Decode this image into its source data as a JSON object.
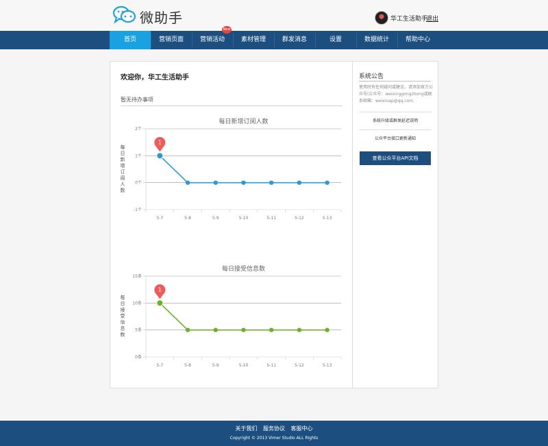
{
  "header": {
    "logo_text": "微助手",
    "username": "华工生活助手",
    "logout": "退出"
  },
  "nav": {
    "items": [
      "首页",
      "营销页面",
      "营销活动",
      "素材管理",
      "群发消息",
      "设置",
      "数据统计",
      "帮助中心"
    ],
    "active_index": 0,
    "badge": "New"
  },
  "main": {
    "welcome": "欢迎你，华工生活助手",
    "todo": "暂无待办事项"
  },
  "chart_data": [
    {
      "type": "line",
      "title": "每日新增订阅人数",
      "ylabel": "每日新增订阅人数",
      "x": [
        "5-7",
        "5-8",
        "5-9",
        "5-10",
        "5-11",
        "5-12",
        "5-13"
      ],
      "y_ticks": [
        "2个",
        "1个",
        "0个",
        "-1个"
      ],
      "ylim": [
        -1,
        2
      ],
      "values": [
        1,
        0,
        0,
        0,
        0,
        0,
        0
      ],
      "color": "#2b9ad6",
      "marker_label": "1",
      "grid": true
    },
    {
      "type": "line",
      "title": "每日接受信息数",
      "ylabel": "每日接受信息数",
      "x": [
        "5-7",
        "5-8",
        "5-9",
        "5-10",
        "5-11",
        "5-12",
        "5-13"
      ],
      "y_ticks": [
        "15条",
        "10条",
        "5条",
        "0条"
      ],
      "ylim": [
        0,
        15
      ],
      "values": [
        10,
        5,
        5,
        5,
        5,
        5,
        5
      ],
      "color": "#6bb125",
      "marker_label": "1",
      "grid": true
    }
  ],
  "sidebar": {
    "title": "系统公告",
    "text": "使用时有任何疑问或建议，请添加官方公众号(公众号：weixinggongzhong或联系邮箱：weixinap@qq.com",
    "links": [
      "系统升级或群发延迟说明",
      "公众平台接口更新通知"
    ],
    "api_button": "查看公众平台API文档"
  },
  "footer": {
    "links": [
      "关于我们",
      "服务协议",
      "客服中心"
    ],
    "copyright": "Copyright © 2013 Vimer Studio ALL Rights"
  },
  "colors": {
    "nav_bg": "#1c4f7f",
    "nav_active": "#1aa1e1",
    "marker": "#f25a5a"
  }
}
